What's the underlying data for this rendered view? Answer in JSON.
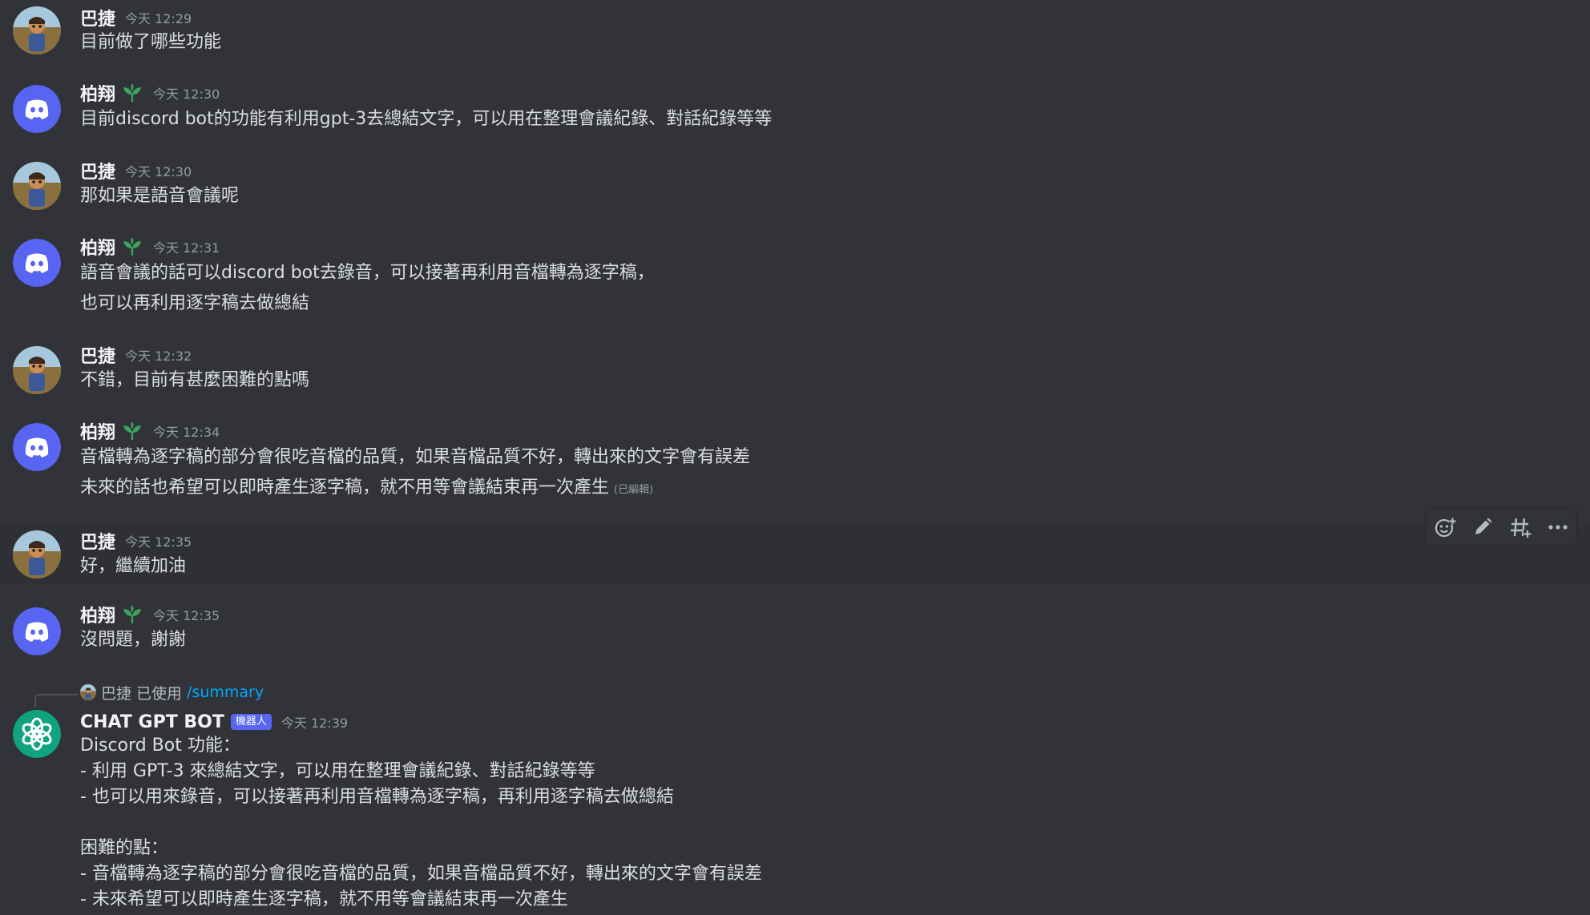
{
  "messages": [
    {
      "author": "巴捷",
      "time": "今天 12:29",
      "lines": [
        "目前做了哪些功能"
      ]
    },
    {
      "author": "柏翔",
      "time": "今天 12:30",
      "lines": [
        "目前discord bot的功能有利用gpt-3去總結文字，可以用在整理會議紀錄、對話紀錄等等"
      ]
    },
    {
      "author": "巴捷",
      "time": "今天 12:30",
      "lines": [
        "那如果是語音會議呢"
      ]
    },
    {
      "author": "柏翔",
      "time": "今天 12:31",
      "lines": [
        "語音會議的話可以discord bot去錄音，可以接著再利用音檔轉為逐字稿，",
        "也可以再利用逐字稿去做總結"
      ]
    },
    {
      "author": "巴捷",
      "time": "今天 12:32",
      "lines": [
        "不錯，目前有甚麼困難的點嗎"
      ]
    },
    {
      "author": "柏翔",
      "time": "今天 12:34",
      "lines": [
        "音檔轉為逐字稿的部分會很吃音檔的品質，如果音檔品質不好，轉出來的文字會有誤差",
        "未來的話也希望可以即時產生逐字稿，就不用等會議結束再一次產生"
      ],
      "edited": "(已編輯)"
    },
    {
      "author": "巴捷",
      "time": "今天 12:35",
      "lines": [
        "好，繼續加油"
      ]
    },
    {
      "author": "柏翔",
      "time": "今天 12:35",
      "lines": [
        "沒問題，謝謝"
      ]
    }
  ],
  "bot_message": {
    "reply": {
      "user": "巴捷",
      "used": "已使用",
      "command": "/summary"
    },
    "author": "CHAT GPT BOT",
    "badge": "機器人",
    "time": "今天 12:39",
    "lines": [
      "Discord Bot 功能：",
      "- 利用 GPT-3 來總結文字，可以用在整理會議紀錄、對話紀錄等等",
      "- 也可以用來錄音，可以接著再利用音檔轉為逐字稿，再利用逐字稿去做總結",
      "",
      "困難的點：",
      "- 音檔轉為逐字稿的部分會很吃音檔的品質，如果音檔品質不好，轉出來的文字會有誤差",
      "- 未來希望可以即時產生逐字稿，就不用等會議結束再一次產生"
    ]
  },
  "toolbar": {
    "icons": [
      "add-reaction-icon",
      "edit-icon",
      "create-thread-icon",
      "more-options-icon"
    ]
  },
  "colors": {
    "background": "#313338",
    "hover_background": "#2e3035",
    "text": "#dbdee1",
    "username": "#f2f3f5",
    "timestamp": "#949ba4",
    "blurple": "#5865f2",
    "link": "#00a8fc",
    "gpt_green": "#10a37f",
    "leaf_green": "#3ba55c"
  }
}
